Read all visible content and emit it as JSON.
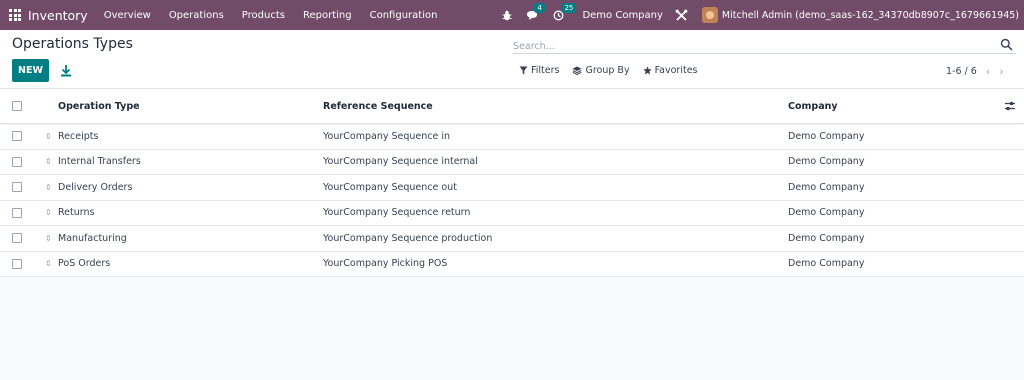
{
  "topbar": {
    "app_title": "Inventory",
    "menu": [
      "Overview",
      "Operations",
      "Products",
      "Reporting",
      "Configuration"
    ],
    "messages_count": "4",
    "activities_count": "25",
    "company": "Demo Company",
    "user": "Mitchell Admin (demo_saas-162_34370db8907c_1679661945)"
  },
  "control": {
    "title": "Operations Types",
    "new_label": "NEW",
    "search_placeholder": "Search...",
    "filters_label": "Filters",
    "group_by_label": "Group By",
    "favorites_label": "Favorites",
    "pager": "1-6 / 6"
  },
  "table": {
    "headers": [
      "Operation Type",
      "Reference Sequence",
      "Company"
    ],
    "rows": [
      [
        "Receipts",
        "YourCompany Sequence in",
        "Demo Company"
      ],
      [
        "Internal Transfers",
        "YourCompany Sequence internal",
        "Demo Company"
      ],
      [
        "Delivery Orders",
        "YourCompany Sequence out",
        "Demo Company"
      ],
      [
        "Returns",
        "YourCompany Sequence return",
        "Demo Company"
      ],
      [
        "Manufacturing",
        "YourCompany Sequence production",
        "Demo Company"
      ],
      [
        "PoS Orders",
        "YourCompany Picking POS",
        "Demo Company"
      ]
    ]
  },
  "colors": {
    "brand": "#714b67",
    "primary": "#017e84"
  }
}
